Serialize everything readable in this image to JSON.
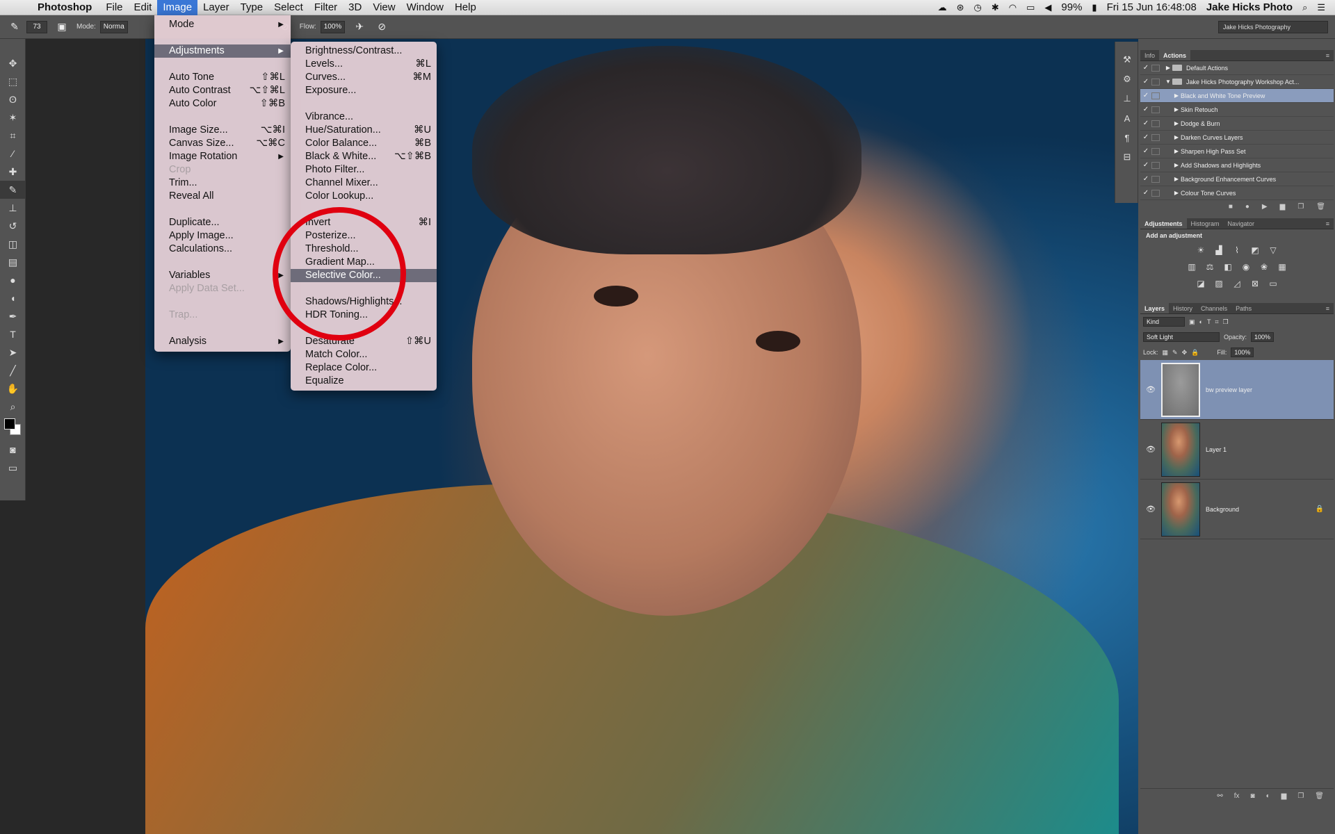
{
  "menubar": {
    "app_name": "Photoshop",
    "menus": [
      "File",
      "Edit",
      "Image",
      "Layer",
      "Type",
      "Select",
      "Filter",
      "3D",
      "View",
      "Window",
      "Help"
    ],
    "battery": "99%",
    "datetime": "Fri 15 Jun  16:48:08",
    "user": "Jake Hicks Photo"
  },
  "options": {
    "brush_size": "73",
    "mode_label": "Mode:",
    "mode_value": "Norma",
    "flow_label": "Flow:",
    "flow_value": "100%",
    "workspace": "Jake Hicks Photography"
  },
  "image_menu": {
    "mode": "Mode",
    "adjustments": "Adjustments",
    "auto_tone": {
      "label": "Auto Tone",
      "sc": "⇧⌘L"
    },
    "auto_contrast": {
      "label": "Auto Contrast",
      "sc": "⌥⇧⌘L"
    },
    "auto_color": {
      "label": "Auto Color",
      "sc": "⇧⌘B"
    },
    "image_size": {
      "label": "Image Size...",
      "sc": "⌥⌘I"
    },
    "canvas_size": {
      "label": "Canvas Size...",
      "sc": "⌥⌘C"
    },
    "image_rotation": "Image Rotation",
    "crop": "Crop",
    "trim": "Trim...",
    "reveal_all": "Reveal All",
    "duplicate": "Duplicate...",
    "apply_image": "Apply Image...",
    "calculations": "Calculations...",
    "variables": "Variables",
    "apply_data_set": "Apply Data Set...",
    "trap": "Trap...",
    "analysis": "Analysis"
  },
  "adjustments_menu": {
    "brightness_contrast": "Brightness/Contrast...",
    "levels": {
      "label": "Levels...",
      "sc": "⌘L"
    },
    "curves": {
      "label": "Curves...",
      "sc": "⌘M"
    },
    "exposure": "Exposure...",
    "vibrance": "Vibrance...",
    "hue_saturation": {
      "label": "Hue/Saturation...",
      "sc": "⌘U"
    },
    "color_balance": {
      "label": "Color Balance...",
      "sc": "⌘B"
    },
    "black_white": {
      "label": "Black & White...",
      "sc": "⌥⇧⌘B"
    },
    "photo_filter": "Photo Filter...",
    "channel_mixer": "Channel Mixer...",
    "color_lookup": "Color Lookup...",
    "invert": {
      "label": "Invert",
      "sc": "⌘I"
    },
    "posterize": "Posterize...",
    "threshold": "Threshold...",
    "gradient_map": "Gradient Map...",
    "selective_color": "Selective Color...",
    "shadows_highlights": "Shadows/Highlights...",
    "hdr_toning": "HDR Toning...",
    "desaturate": {
      "label": "Desaturate",
      "sc": "⇧⌘U"
    },
    "match_color": "Match Color...",
    "replace_color": "Replace Color...",
    "equalize": "Equalize"
  },
  "actions_panel": {
    "tabs": [
      "Info",
      "Actions"
    ],
    "rows": [
      {
        "label": "Default Actions",
        "kind": "set"
      },
      {
        "label": "Jake Hicks Photography Workshop Act...",
        "kind": "set"
      },
      {
        "label": "Black and White Tone Preview",
        "kind": "action"
      },
      {
        "label": "Skin Retouch",
        "kind": "action"
      },
      {
        "label": "Dodge & Burn",
        "kind": "action"
      },
      {
        "label": "Darken Curves Layers",
        "kind": "action"
      },
      {
        "label": "Sharpen High Pass Set",
        "kind": "action"
      },
      {
        "label": "Add Shadows and Highlights",
        "kind": "action"
      },
      {
        "label": "Background Enhancement Curves",
        "kind": "action"
      },
      {
        "label": "Colour Tone Curves",
        "kind": "action"
      }
    ]
  },
  "adjustments_panel": {
    "tabs": [
      "Adjustments",
      "Histogram",
      "Navigator"
    ],
    "title": "Add an adjustment"
  },
  "layers_panel": {
    "tabs": [
      "Layers",
      "History",
      "Channels",
      "Paths"
    ],
    "kind_label": "Kind",
    "blend_mode": "Soft Light",
    "opacity_label": "Opacity:",
    "opacity": "100%",
    "lock_label": "Lock:",
    "fill_label": "Fill:",
    "fill": "100%",
    "layers": [
      {
        "name": "bw preview layer"
      },
      {
        "name": "Layer 1"
      },
      {
        "name": "Background"
      }
    ]
  },
  "colors": {
    "annotation": "#e00010",
    "menu_highlight": "#6e6c7a",
    "layer_selected": "#7e91b3"
  }
}
